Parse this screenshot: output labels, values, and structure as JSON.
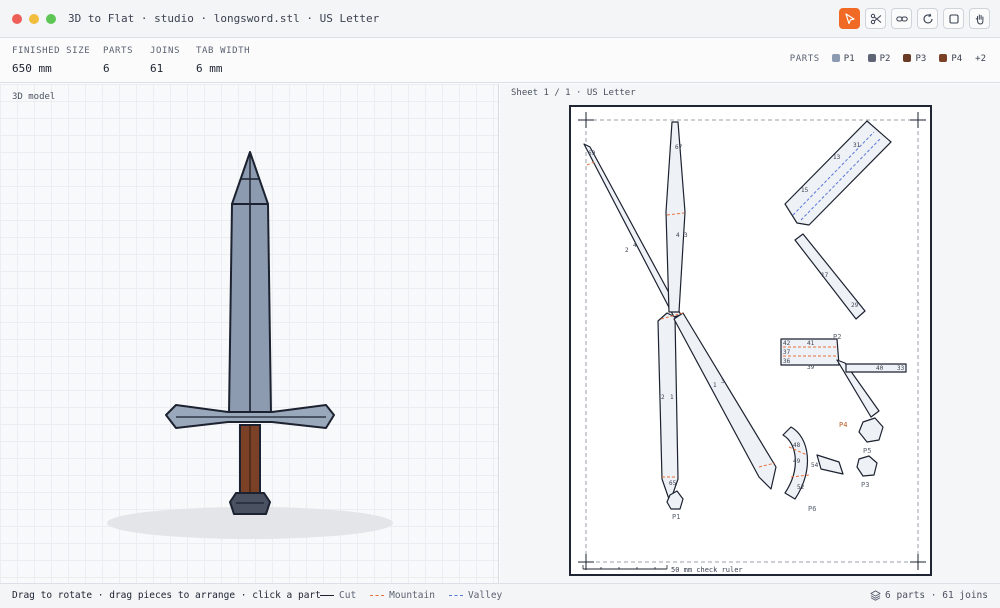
{
  "window": {
    "title": "3D to Flat · studio · longsword.stl · US Letter"
  },
  "toolbar": {
    "tools": [
      {
        "icon": "cursor-icon",
        "active": true
      },
      {
        "icon": "scissors-icon",
        "active": false
      },
      {
        "icon": "link-icon",
        "active": false
      },
      {
        "icon": "refresh-icon",
        "active": false
      },
      {
        "icon": "square-icon",
        "active": false
      },
      {
        "icon": "hand-icon",
        "active": false
      }
    ]
  },
  "stats": {
    "finished_size_label": "FINISHED SIZE",
    "finished_size": "650 mm",
    "parts_label": "PARTS",
    "parts": "6",
    "joins_label": "JOINS",
    "joins": "61",
    "tab_width_label": "TAB WIDTH",
    "tab_width": "6 mm"
  },
  "parts_legend": {
    "label": "PARTS",
    "items": [
      {
        "name": "P1",
        "color": "#8c9bb0"
      },
      {
        "name": "P2",
        "color": "#5d6576"
      },
      {
        "name": "P3",
        "color": "#6a3a24"
      },
      {
        "name": "P4",
        "color": "#7a4126"
      }
    ],
    "more": "+2"
  },
  "model_pane": {
    "label": "3D model"
  },
  "sheet_pane": {
    "label": "Sheet 1 / 1 · US Letter",
    "ruler_label": "50 mm check ruler",
    "part_labels": [
      "P1",
      "P2",
      "P3",
      "P4",
      "P5",
      "P6"
    ]
  },
  "footer": {
    "hint": "Drag to rotate · drag pieces to arrange · click a part",
    "legend": {
      "cut": "Cut",
      "mountain": "Mountain",
      "valley": "Valley"
    },
    "summary": "6 parts · 61 joins"
  },
  "colors": {
    "accent": "#f06a26",
    "cut": "#1c2230",
    "mountain": "#e8703a",
    "valley": "#5a78d8"
  }
}
